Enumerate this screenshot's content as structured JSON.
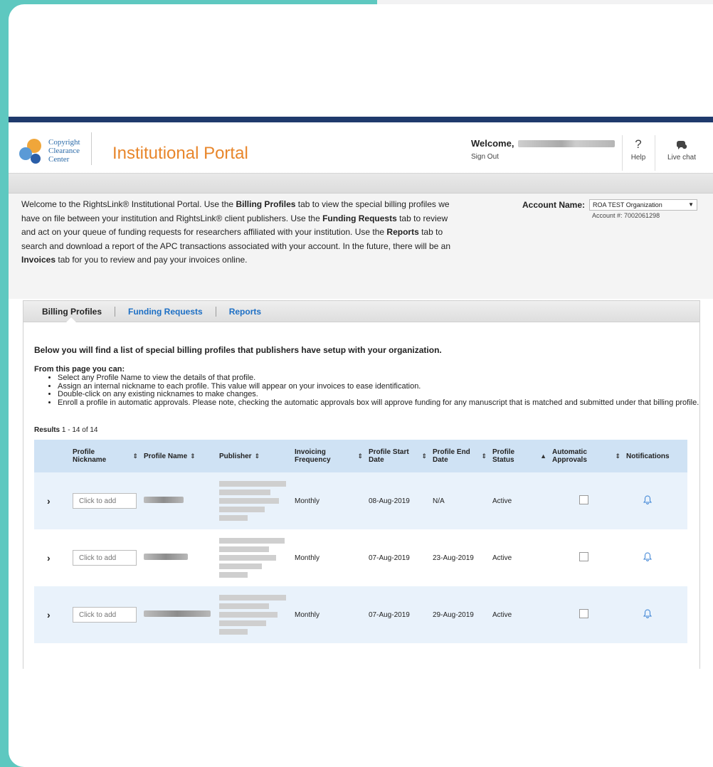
{
  "header": {
    "logo_text": [
      "Copyright",
      "Clearance",
      "Center"
    ],
    "title": "Institutional Portal",
    "welcome_label": "Welcome,",
    "sign_out": "Sign Out",
    "help_label": "Help",
    "help_glyph": "?",
    "livechat_label": "Live chat"
  },
  "intro": {
    "p1": "Welcome to the RightsLink® Institutional Portal. Use the ",
    "b1": "Billing Profiles",
    "p2": " tab to view the special billing profiles we have on file between your institution and RightsLink® client publishers. Use the ",
    "b2": "Funding Requests",
    "p3": " tab to review and act on your queue of funding requests for researchers affiliated with your institution. Use the ",
    "b3": "Reports",
    "p4": " tab to search and download a report of the APC transactions associated with your account. In the future, there will be an ",
    "b4": "Invoices",
    "p5": " tab for you to review and pay your invoices online."
  },
  "account": {
    "label": "Account Name:",
    "selected": "ROA TEST Organization",
    "number": "Account #: 7002061298"
  },
  "tabs": [
    {
      "label": "Billing Profiles",
      "active": true
    },
    {
      "label": "Funding Requests",
      "active": false
    },
    {
      "label": "Reports",
      "active": false
    }
  ],
  "content": {
    "lead": "Below you will find a list of special billing profiles that publishers have setup with your organization.",
    "can_heading": "From this page you can:",
    "bullets": [
      "Select any Profile Name to view the details of that profile.",
      "Assign an internal nickname to each profile. This value will appear on your invoices to ease identification.",
      "Double-click on any existing nicknames to make changes.",
      "Enroll a profile in automatic approvals. Please note, checking the automatic approvals box will approve funding for any manuscript that is matched and submitted under that billing profile."
    ],
    "results_label": "Results",
    "results_range": " 1 - 14 of 14"
  },
  "table": {
    "headers": {
      "nickname": "Profile Nickname",
      "name": "Profile Name",
      "publisher": "Publisher",
      "frequency": "Invoicing Frequency",
      "start": "Profile Start Date",
      "end": "Profile End Date",
      "status": "Profile Status",
      "auto": "Automatic Approvals",
      "notifications": "Notifications"
    },
    "sort_glyph": "⇕",
    "sort_up_glyph": "▲",
    "nickname_placeholder": "Click to add",
    "rows": [
      {
        "frequency": "Monthly",
        "start": "08-Aug-2019",
        "end": "N/A",
        "status": "Active"
      },
      {
        "frequency": "Monthly",
        "start": "07-Aug-2019",
        "end": "23-Aug-2019",
        "status": "Active"
      },
      {
        "frequency": "Monthly",
        "start": "07-Aug-2019",
        "end": "29-Aug-2019",
        "status": "Active"
      }
    ]
  },
  "icons": {
    "help": "question-icon",
    "chat": "chat-bubble-icon",
    "bell": "bell-icon",
    "expand": "chevron-right-icon",
    "caret": "caret-down-icon"
  },
  "colors": {
    "accent_orange": "#e8862b",
    "link_blue": "#1d6fc4",
    "header_blue": "#cfe2f4",
    "top_stripe": "#1f3a6c",
    "teal": "#5ec8c0"
  }
}
